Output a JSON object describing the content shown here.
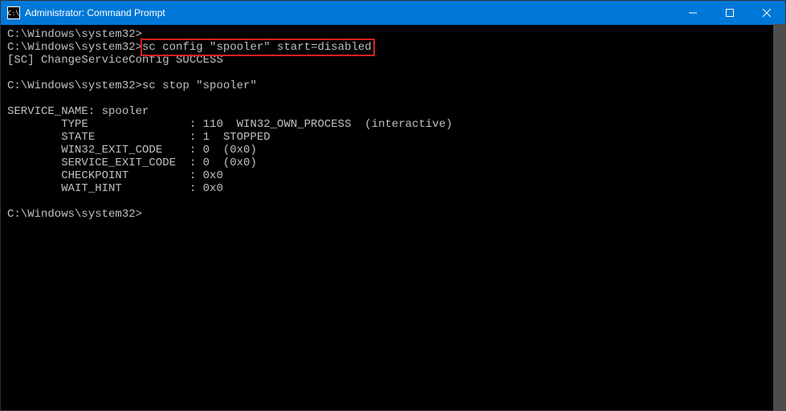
{
  "window": {
    "title": "Administrator: Command Prompt",
    "icon_text": "C:\\"
  },
  "terminal": {
    "line1_prompt": "C:\\Windows\\system32>",
    "line2_prompt": "C:\\Windows\\system32>",
    "line2_cmd": "sc config \"spooler\" start=disabled",
    "line3": "[SC] ChangeServiceConfig SUCCESS",
    "line5_prompt": "C:\\Windows\\system32>",
    "line5_cmd": "sc stop \"spooler\"",
    "line7": "SERVICE_NAME: spooler",
    "line8": "        TYPE               : 110  WIN32_OWN_PROCESS  (interactive)",
    "line9": "        STATE              : 1  STOPPED",
    "line10": "        WIN32_EXIT_CODE    : 0  (0x0)",
    "line11": "        SERVICE_EXIT_CODE  : 0  (0x0)",
    "line12": "        CHECKPOINT         : 0x0",
    "line13": "        WAIT_HINT          : 0x0",
    "line15_prompt": "C:\\Windows\\system32>"
  }
}
